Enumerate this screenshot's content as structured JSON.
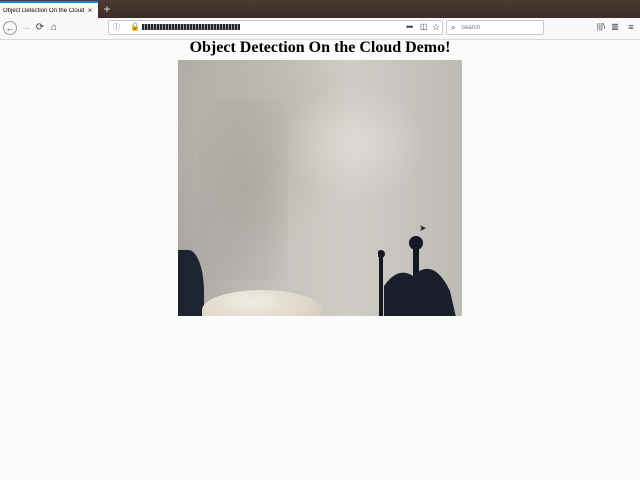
{
  "browser": {
    "tab": {
      "title": "Object Detection On the Cloud Demo!",
      "close_glyph": "×"
    },
    "new_tab_glyph": "+",
    "nav": {
      "back_glyph": "←",
      "forward_glyph": "→",
      "reload_glyph": "⟳",
      "home_glyph": "⌂"
    },
    "urlbar": {
      "info_glyph": "ⓘ",
      "lock_glyph": "🔒",
      "more_glyph": "•••",
      "pocket_glyph": "◫",
      "star_glyph": "☆"
    },
    "search": {
      "placeholder": "Search",
      "icon_glyph": "⌕"
    },
    "toolbar": {
      "library_glyph": "|||\\",
      "sidebar_glyph": "▥",
      "menu_glyph": "≡"
    }
  },
  "page": {
    "title": "Object Detection On the Cloud Demo!"
  },
  "colors": {
    "tabstrip": "#4a3a32",
    "accent": "#0a84ff",
    "page_bg": "#fbfbfb"
  }
}
